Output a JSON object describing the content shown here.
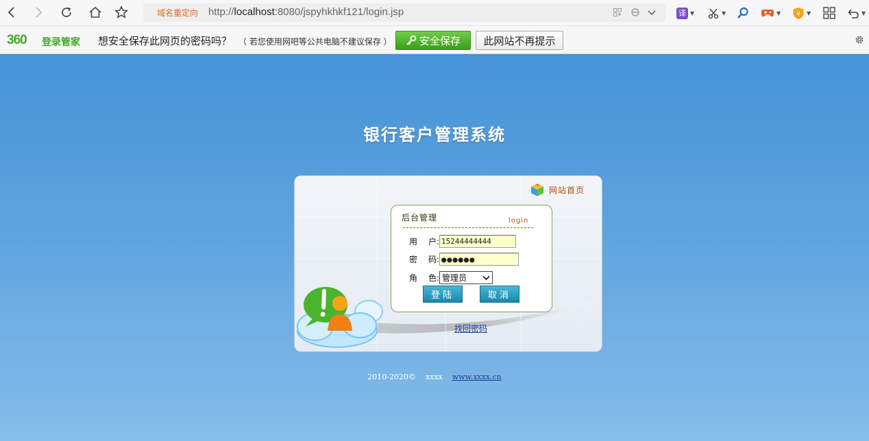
{
  "browser": {
    "redirect_tag": "域名重定向",
    "url_prefix": "http://",
    "url_host": "localhost",
    "url_rest": ":8080/jspyhkhkf121/login.jsp",
    "extensions": [
      "translate-icon",
      "scissors-icon",
      "search-icon",
      "game-icon",
      "wallet-icon",
      "apps-grid-icon",
      "undo-icon"
    ],
    "translate_label": "译"
  },
  "password_bar": {
    "brand_logo": "360",
    "brand_name": "登录管家",
    "question": "想安全保存此网页的密码吗？",
    "note": "（ 若您使用网吧等公共电脑不建议保存 ）",
    "save_label": "安全保存",
    "never_label": "此网站不再提示"
  },
  "page": {
    "title": "银行客户管理系统",
    "home_link": "网站首页",
    "box_title": "后台管理",
    "box_login": "login",
    "form": {
      "username_label_1": "用",
      "username_label_2": "户:",
      "username_value": "15244444444",
      "password_label_1": "密",
      "password_label_2": "码:",
      "password_value": "●●●●●●",
      "role_label_1": "角",
      "role_label_2": "色:",
      "role_value": "管理员",
      "login_label": "登陆",
      "cancel_label": "取消"
    },
    "recover_link": "找回密码",
    "footer_copyright": "2010-2020©",
    "footer_owner": "xxxx",
    "footer_link": "www.xxxx.cn"
  },
  "colors": {
    "page_top": "#4693d6",
    "page_bottom": "#86bde9",
    "brand_green": "#44a828",
    "button_blue": "#1b87ad"
  }
}
